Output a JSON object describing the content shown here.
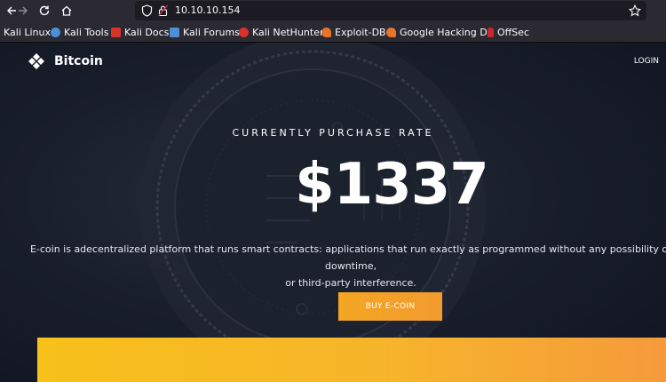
{
  "browser": {
    "url": "10.10.10.154",
    "bookmarks": [
      {
        "label": "Kali Linux",
        "icon": "kali-dragon-icon",
        "color": "#3b8eea"
      },
      {
        "label": "Kali Tools",
        "icon": "kali-tools-icon",
        "color": "#4a90d9"
      },
      {
        "label": "Kali Docs",
        "icon": "kali-docs-icon",
        "color": "#d9322b"
      },
      {
        "label": "Kali Forums",
        "icon": "kali-forums-icon",
        "color": "#4d8fd6"
      },
      {
        "label": "Kali NetHunter",
        "icon": "nethunter-icon",
        "color": "#d9322b"
      },
      {
        "label": "Exploit-DB",
        "icon": "exploit-db-icon",
        "color": "#e8742c"
      },
      {
        "label": "Google Hacking DB",
        "icon": "ghdb-icon",
        "color": "#e8742c"
      },
      {
        "label": "OffSec",
        "icon": "offsec-icon",
        "color": "#c9262b"
      }
    ]
  },
  "header": {
    "brand": "Bitcoin",
    "login": "LOGIN"
  },
  "hero": {
    "rate_label": "CURRENTLY PURCHASE RATE",
    "price": "$1337",
    "description_line1": "E-coin is adecentralized platform that runs smart contracts: applications that run exactly as programmed without any possibility of downtime,",
    "description_line2": "or third-party interference.",
    "button": "BUY E-COIN"
  },
  "colors": {
    "accent": "#f5a623",
    "band_start": "#f7c01a",
    "band_end": "#f59a3c"
  }
}
